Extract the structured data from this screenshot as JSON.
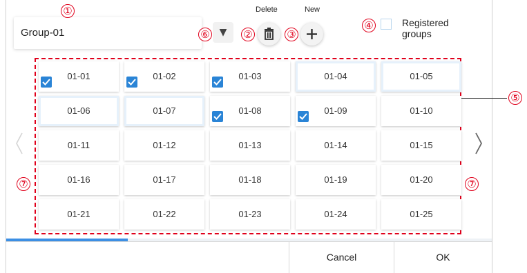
{
  "header": {
    "group_name": "Group-01",
    "dropdown_glyph": "▼",
    "delete_label": "Delete",
    "new_label": "New",
    "registered_label_line1": "Registered",
    "registered_label_line2": "groups",
    "registered_checked": false
  },
  "callouts": [
    "①",
    "②",
    "③",
    "④",
    "⑤",
    "⑥",
    "⑦",
    "⑦"
  ],
  "grid": {
    "cells": [
      {
        "label": "01-01",
        "checked": true
      },
      {
        "label": "01-02",
        "checked": true
      },
      {
        "label": "01-03",
        "checked": true
      },
      {
        "label": "01-04",
        "checked": false,
        "highlight": true
      },
      {
        "label": "01-05",
        "checked": false,
        "highlight": true
      },
      {
        "label": "01-06",
        "checked": false,
        "highlight": true
      },
      {
        "label": "01-07",
        "checked": false,
        "highlight": true
      },
      {
        "label": "01-08",
        "checked": true
      },
      {
        "label": "01-09",
        "checked": true
      },
      {
        "label": "01-10",
        "checked": false
      },
      {
        "label": "01-11",
        "checked": false
      },
      {
        "label": "01-12",
        "checked": false
      },
      {
        "label": "01-13",
        "checked": false
      },
      {
        "label": "01-14",
        "checked": false
      },
      {
        "label": "01-15",
        "checked": false
      },
      {
        "label": "01-16",
        "checked": false
      },
      {
        "label": "01-17",
        "checked": false
      },
      {
        "label": "01-18",
        "checked": false
      },
      {
        "label": "01-19",
        "checked": false
      },
      {
        "label": "01-20",
        "checked": false
      },
      {
        "label": "01-21",
        "checked": false
      },
      {
        "label": "01-22",
        "checked": false
      },
      {
        "label": "01-23",
        "checked": false
      },
      {
        "label": "01-24",
        "checked": false
      },
      {
        "label": "01-25",
        "checked": false
      }
    ]
  },
  "page_progress": 0.25,
  "footer": {
    "cancel_label": "Cancel",
    "ok_label": "OK"
  },
  "colors": {
    "annotation": "#e0001b",
    "checkbox": "#2a84d6",
    "progress": "#3c8fe4"
  },
  "icons": {
    "delete": "trash-icon",
    "new": "plus-icon",
    "prev": "chevron-left-icon",
    "next": "chevron-right-icon",
    "check": "checkmark-icon"
  }
}
